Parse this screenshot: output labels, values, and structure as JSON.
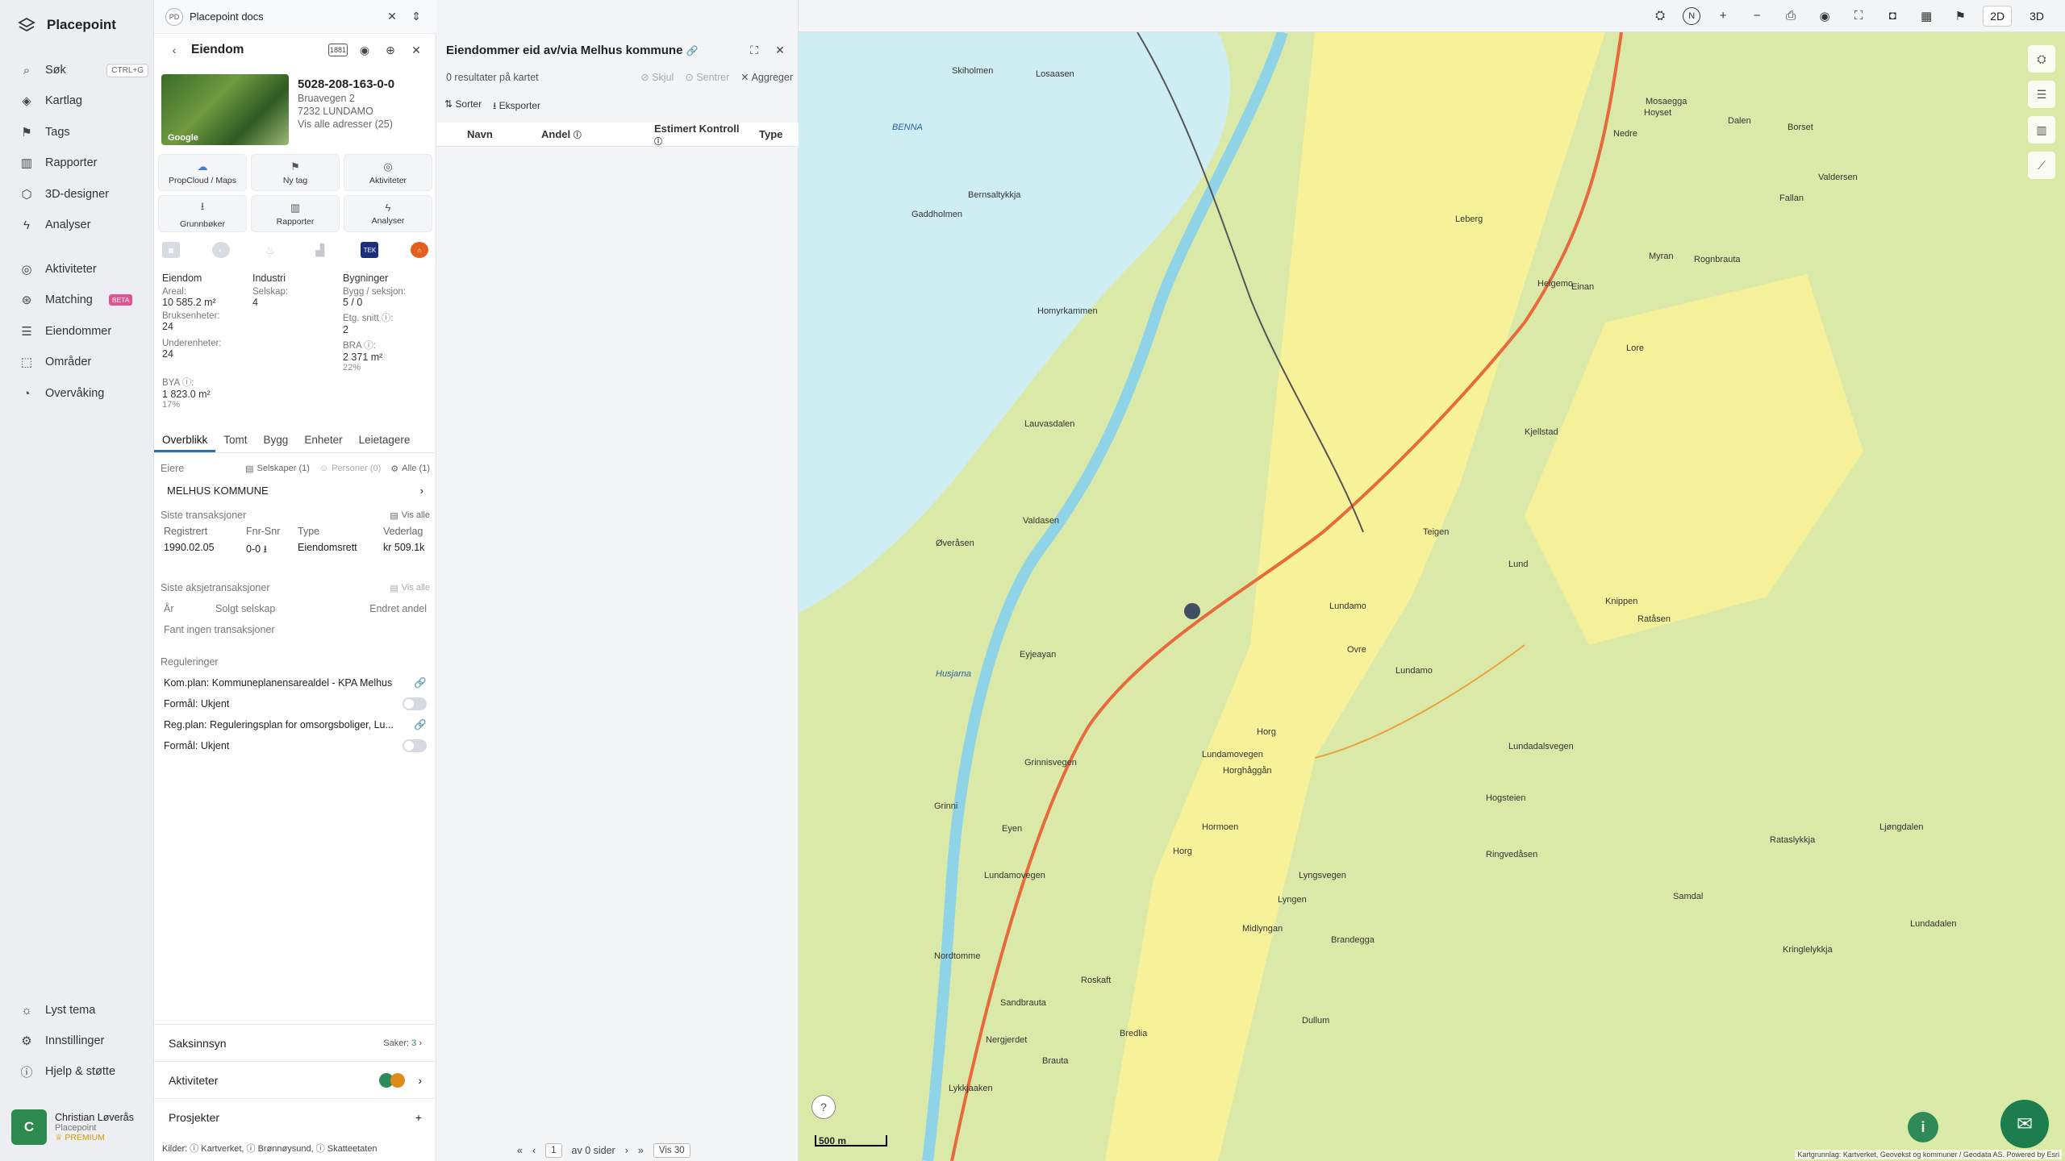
{
  "brand": {
    "name": "Placepoint"
  },
  "nav": {
    "items": [
      {
        "label": "Søk",
        "icon": "search-icon",
        "kbd": "CTRL+G"
      },
      {
        "label": "Kartlag",
        "icon": "layers-icon"
      },
      {
        "label": "Tags",
        "icon": "bookmark-icon"
      },
      {
        "label": "Rapporter",
        "icon": "chart-icon"
      },
      {
        "label": "3D-designer",
        "icon": "cube-icon"
      },
      {
        "label": "Analyser",
        "icon": "bolt-icon"
      },
      {
        "label": "Aktiviteter",
        "icon": "activity-icon"
      },
      {
        "label": "Matching",
        "icon": "matching-icon",
        "badge": "BETA"
      },
      {
        "label": "Eiendommer",
        "icon": "list-icon"
      },
      {
        "label": "Områder",
        "icon": "area-icon"
      },
      {
        "label": "Overvåking",
        "icon": "monitor-icon"
      }
    ],
    "bottom": [
      {
        "label": "Lyst tema",
        "icon": "sun-icon"
      },
      {
        "label": "Innstillinger",
        "icon": "gear-icon"
      },
      {
        "label": "Hjelp & støtte",
        "icon": "help-icon"
      }
    ],
    "user": {
      "initial": "C",
      "name": "Christian Løverås",
      "org": "Placepoint",
      "plan": "PREMIUM"
    }
  },
  "panel": {
    "doc_tab": "Placepoint docs",
    "doc_logo": "PD",
    "title": "Eiendom",
    "photo_label": "Google",
    "prop_id": "5028-208-163-0-0",
    "address": "Bruavegen 2",
    "postal": "7232 LUNDAMO",
    "all_addresses": "Vis alle adresser (25)",
    "actions": [
      "PropCloud / Maps",
      "Ny tag",
      "Aktiviteter",
      "Grunnbøker",
      "Rapporter",
      "Analyser"
    ],
    "source_tek": "TEK",
    "stats": {
      "col1": "Eiendom",
      "col2": "Industri",
      "col3": "Bygninger",
      "areal_k": "Areal:",
      "areal_v": "10 585.2 m²",
      "selskap_k": "Selskap:",
      "selskap_v": "4",
      "bygg_k": "Bygg / seksjon:",
      "bygg_v": "5 / 0",
      "bruks_k": "Bruksenheter:",
      "bruks_v": "24",
      "etg_k": "Etg. snitt ⓘ:",
      "etg_v": "2",
      "under_k": "Underenheter:",
      "under_v": "24",
      "bra_k": "BRA ⓘ:",
      "bra_v": "2 371 m²",
      "bra_p": "22%",
      "bya_k": "BYA ⓘ:",
      "bya_v": "1 823.0 m²",
      "bya_p": "17%"
    },
    "tabs": [
      "Overblikk",
      "Tomt",
      "Bygg",
      "Enheter",
      "Leietagere"
    ],
    "owners": {
      "label": "Eiere",
      "selskaper": "Selskaper (1)",
      "personer": "Personer (0)",
      "alle": "Alle (1)",
      "owner": "MELHUS KOMMUNE"
    },
    "trans": {
      "label": "Siste transaksjoner",
      "show_all": "Vis alle",
      "headers": [
        "Registrert",
        "Fnr-Snr",
        "Type",
        "Vederlag"
      ],
      "row": [
        "1990.02.05",
        "0-0",
        "Eiendomsrett",
        "kr 509.1k"
      ]
    },
    "stock": {
      "label": "Siste aksjetransaksjoner",
      "show_all": "Vis alle",
      "headers": [
        "År",
        "Solgt selskap",
        "Endret andel"
      ],
      "empty": "Fant ingen transaksjoner"
    },
    "reg": {
      "label": "Reguleringer",
      "k1": "Kom.plan: Kommuneplanensarealdel - KPA Melhus",
      "f1": "Formål: Ukjent",
      "k2": "Reg.plan: Reguleringsplan for omsorgsboliger, Lu...",
      "f2": "Formål: Ukjent"
    },
    "sak": {
      "label": "Saksinnsyn",
      "count_label": "Saker:",
      "count": "3"
    },
    "akt": {
      "label": "Aktiviteter"
    },
    "prosj": {
      "label": "Prosjekter"
    },
    "sources": "Kilder: ⓘ Kartverket, ⓘ Brønnøysund, ⓘ Skatteetaten"
  },
  "results": {
    "title": "Eiendommer eid av/via Melhus kommune",
    "count": "0 resultater på kartet",
    "skjul": "Skjul",
    "sentrer": "Sentrer",
    "aggreger": "Aggreger",
    "sorter": "Sorter",
    "eksporter": "Eksporter",
    "cols": [
      "Navn",
      "Andel",
      "Estimert Kontroll",
      "Type"
    ],
    "pager": {
      "page": "1",
      "of": "av 0 sider",
      "per": "Vis 30"
    }
  },
  "map": {
    "dims": [
      "2D",
      "3D"
    ],
    "scale": "500 m",
    "attribution": "Kartgrunnlag: Kartverket, Geovekst og kommuner / Geodata AS. Powered by Esri",
    "labels": [
      "BENNA",
      "Losaasen",
      "Skiholmen",
      "Gaddholmen",
      "Bernsaltykkja",
      "Homyrkammen",
      "Lauvasdalen",
      "Øveråsen",
      "Valdasen",
      "Eyjeayan",
      "Husjarna",
      "Grinni",
      "Eyen",
      "Lundamo",
      "Lundamo",
      "Teigen",
      "Lund",
      "Horg",
      "Horghåggån",
      "Hormoen",
      "Horg",
      "Lyngen",
      "Midlyngan",
      "Brandegga",
      "Ringvedåsen",
      "Hogsteien",
      "Knippen",
      "Ratåsen",
      "Lundadalsvegen",
      "Lyngsvegen",
      "Lundamovegen",
      "Grinnisvegen",
      "Leberg",
      "Helgemo",
      "Einan",
      "Lore",
      "Kjellstad",
      "Mosaegga",
      "Dalen",
      "Fallan",
      "Myran",
      "Rognbrauta",
      "Valdersen",
      "Borset",
      "Lundadalen",
      "Kringlelykkja",
      "Samdal",
      "Rataslykkja",
      "Ljøngdalen",
      "Dullum",
      "Roskaft",
      "Bredlia",
      "Brauta",
      "Nordtomme",
      "Sandbrauta",
      "Lykkjaaken",
      "Nergjerdet",
      "Hoyset",
      "Nedre",
      "Lundamovegen",
      "Ovre"
    ]
  }
}
